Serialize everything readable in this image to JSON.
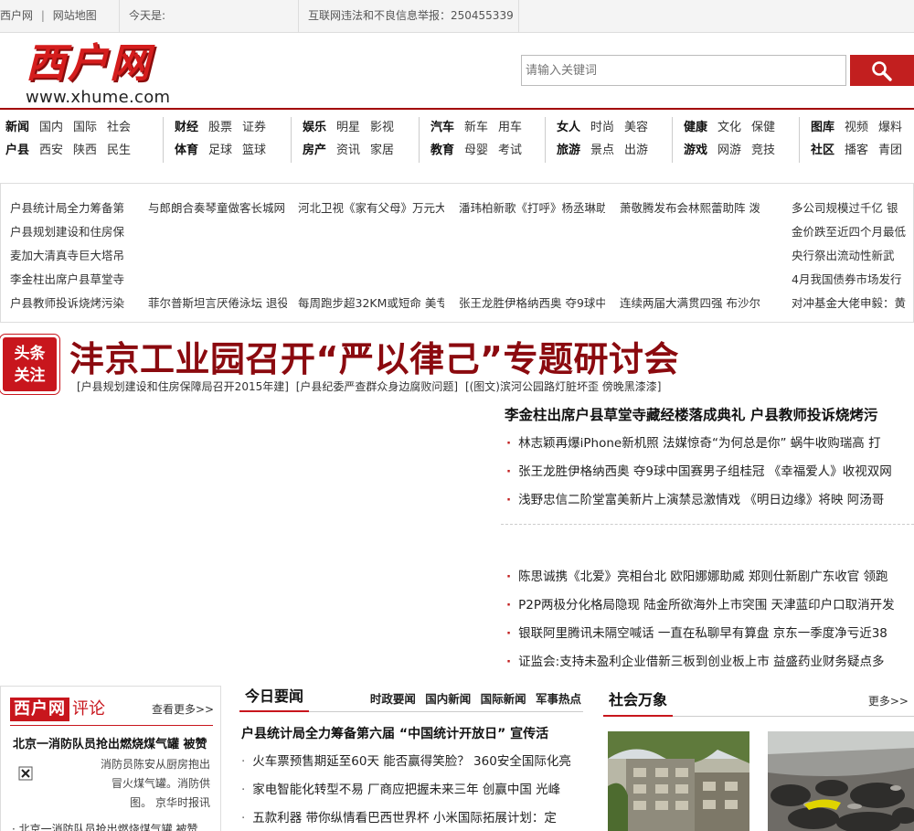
{
  "topbar": {
    "site_link": "西户网",
    "sep": "|",
    "sitemap_link": "网站地图",
    "date_label": "今天是:",
    "report_text": "互联网违法和不良信息举报：250455339"
  },
  "header": {
    "logo_cn": "西户网",
    "logo_en": "www.xhume.com",
    "search_placeholder": "请输入关键词"
  },
  "nav": [
    {
      "rows": [
        [
          "新闻",
          "国内",
          "国际",
          "社会"
        ],
        [
          "户县",
          "西安",
          "陕西",
          "民生"
        ]
      ]
    },
    {
      "rows": [
        [
          "财经",
          "股票",
          "证券"
        ],
        [
          "体育",
          "足球",
          "篮球"
        ]
      ]
    },
    {
      "rows": [
        [
          "娱乐",
          "明星",
          "影视"
        ],
        [
          "房产",
          "资讯",
          "家居"
        ]
      ]
    },
    {
      "rows": [
        [
          "汽车",
          "新车",
          "用车"
        ],
        [
          "教育",
          "母婴",
          "考试"
        ]
      ]
    },
    {
      "rows": [
        [
          "女人",
          "时尚",
          "美容"
        ],
        [
          "旅游",
          "景点",
          "出游"
        ]
      ]
    },
    {
      "rows": [
        [
          "健康",
          "文化",
          "保健"
        ],
        [
          "游戏",
          "网游",
          "竞技"
        ]
      ]
    },
    {
      "rows": [
        [
          "图库",
          "视频",
          "爆料"
        ],
        [
          "社区",
          "播客",
          "青团"
        ]
      ]
    }
  ],
  "ticker": {
    "col1": [
      "户县统计局全力筹备第",
      "户县规划建设和住房保",
      "麦加大清真寺巨大塔吊",
      "李金柱出席户县草堂寺",
      "户县教师投诉烧烤污染"
    ],
    "col2_top": "与郎朗合奏琴童做客长城网",
    "col2_bottom": "菲尔普斯坦言厌倦泳坛 退役",
    "col3_top": "河北卫视《家有父母》万元大",
    "col3_bottom": "每周跑步超32KM或短命 美专",
    "col4_top": "潘玮柏新歌《打呼》杨丞琳助",
    "col4_bottom": "张王龙胜伊格纳西奥 夺9球中",
    "col5_top": "萧敬腾发布会林熙蕾助阵 泼",
    "col5_bottom": "连续两届大满贯四强 布沙尔",
    "col6": [
      "多公司规模过千亿 银",
      "金价跌至近四个月最低",
      "央行祭出流动性新武",
      "4月我国债券市场发行",
      "对冲基金大佬申毅：黄"
    ]
  },
  "headline": {
    "badge_line1": "头条",
    "badge_line2": "关注",
    "title": "沣京工业园召开“严以律己”专题研讨会",
    "sub": [
      "[户县规划建设和住房保障局召开2015年建]",
      "[户县纪委严查群众身边腐败问题]",
      "[(图文)滨河公园路灯脏坏歪 傍晚黑漆漆]"
    ]
  },
  "right_news": {
    "title": "李金柱出席户县草堂寺藏经楼落成典礼 户县教师投诉烧烤污",
    "list1": [
      "林志颖再爆iPhone新机照 法媒惊奇“为何总是你” 蜗牛收购瑞高 打",
      "张王龙胜伊格纳西奥 夺9球中国赛男子组桂冠 《幸福爱人》收视双网",
      "浅野忠信二阶堂富美新片上演禁忌激情戏 《明日边缘》将映 阿汤哥"
    ],
    "list2": [
      "陈思诚携《北爱》亮相台北 欧阳娜娜助威 郑则仕新剧广东收官 领跑",
      "P2P两极分化格局隐现 陆金所欲海外上市突围 天津蓝印户口取消开发",
      "银联阿里腾讯未隔空喊话 一直在私聊早有算盘 京东一季度净亏近38",
      "证监会:支持未盈利企业借新三板到创业板上市 益盛药业财务疑点多"
    ]
  },
  "commentary": {
    "logo_red": "西户网",
    "logo_grey": "评论",
    "more": "查看更多>>",
    "title": "北京一消防队员抢出燃烧煤气罐 被赞",
    "desc": "消防员陈安从厨房抱出冒火煤气罐。消防供图。 京华时报讯",
    "item": "· 北京一消防队员抢出燃烧煤气罐 被赞"
  },
  "today": {
    "tab": "今日要闻",
    "cats": [
      "时政要闻",
      "国内新闻",
      "国际新闻",
      "军事热点"
    ],
    "lead": "户县统计局全力筹备第六届 “中国统计开放日” 宣传活",
    "list": [
      "火车票预售期延至60天 能否赢得笑脸？ 360安全国际化亮",
      "家电智能化转型不易 厂商应把握未来三年 创赢中国 光峰",
      "五款利器 带你纵情看巴西世界杯 小米国际拓展计划：定"
    ]
  },
  "society": {
    "tab": "社会万象",
    "more": "更多>>"
  }
}
